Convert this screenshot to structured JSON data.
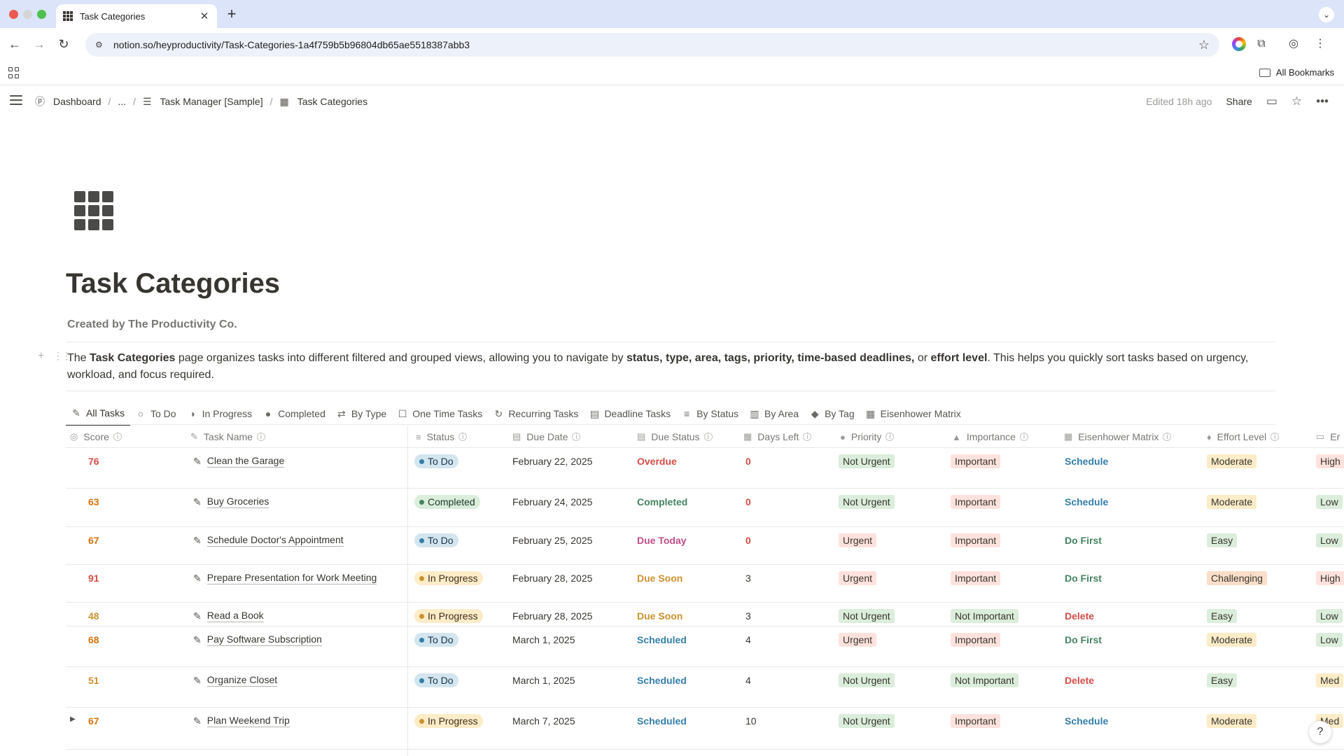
{
  "browser": {
    "tab_title": "Task Categories",
    "url": "notion.so/heyproductivity/Task-Categories-1a4f759b5b96804db65ae5518387abb3",
    "all_bookmarks": "All Bookmarks"
  },
  "breadcrumb": {
    "dashboard": "Dashboard",
    "ellipsis": "...",
    "task_manager": "Task Manager [Sample]",
    "current": "Task Categories"
  },
  "topbar": {
    "edited": "Edited 18h ago",
    "share": "Share"
  },
  "page": {
    "title": "Task Categories",
    "created_by": "Created by The Productivity Co.",
    "desc": {
      "p1": "The ",
      "b1": "Task Categories",
      "p2": " page organizes tasks into different filtered and grouped views, allowing you to navigate by ",
      "b2": "status, type, area, tags, priority, time-based deadlines,",
      "p3": " or ",
      "b3": "effort level",
      "p4": ". This helps you quickly sort tasks based on urgency, workload, and focus required."
    }
  },
  "views": [
    {
      "label": "All Tasks",
      "icon": "edit-icon"
    },
    {
      "label": "To Do",
      "icon": "circle-icon"
    },
    {
      "label": "In Progress",
      "icon": "half-circle-icon"
    },
    {
      "label": "Completed",
      "icon": "filled-circle-icon"
    },
    {
      "label": "By Type",
      "icon": "repeat-icon"
    },
    {
      "label": "One Time Tasks",
      "icon": "square-icon"
    },
    {
      "label": "Recurring Tasks",
      "icon": "refresh-icon"
    },
    {
      "label": "Deadline Tasks",
      "icon": "calendar-icon"
    },
    {
      "label": "By Status",
      "icon": "layers-icon"
    },
    {
      "label": "By Area",
      "icon": "building-icon"
    },
    {
      "label": "By Tag",
      "icon": "tag-icon"
    },
    {
      "label": "Eisenhower Matrix",
      "icon": "grid-icon"
    }
  ],
  "columns": {
    "score": "Score",
    "task_name": "Task Name",
    "status": "Status",
    "due_date": "Due Date",
    "due_status": "Due Status",
    "days_left": "Days Left",
    "priority": "Priority",
    "importance": "Importance",
    "eisenhower": "Eisenhower Matrix",
    "effort": "Effort Level",
    "energy": "Er"
  },
  "rows": [
    {
      "score": "76",
      "name": "Clean the Garage",
      "status": "To Do",
      "due_date": "February 22, 2025",
      "due_status": "Overdue",
      "days_left": "0",
      "priority": "Not Urgent",
      "importance": "Important",
      "eisenhower": "Schedule",
      "effort": "Moderate",
      "energy": "High"
    },
    {
      "score": "63",
      "name": "Buy Groceries",
      "status": "Completed",
      "due_date": "February 24, 2025",
      "due_status": "Completed",
      "days_left": "0",
      "priority": "Not Urgent",
      "importance": "Important",
      "eisenhower": "Schedule",
      "effort": "Moderate",
      "energy": "Low"
    },
    {
      "score": "67",
      "name": "Schedule Doctor's Appointment",
      "status": "To Do",
      "due_date": "February 25, 2025",
      "due_status": "Due Today",
      "days_left": "0",
      "priority": "Urgent",
      "importance": "Important",
      "eisenhower": "Do First",
      "effort": "Easy",
      "energy": "Low"
    },
    {
      "score": "91",
      "name": "Prepare Presentation for Work Meeting",
      "status": "In Progress",
      "due_date": "February 28, 2025",
      "due_status": "Due Soon",
      "days_left": "3",
      "priority": "Urgent",
      "importance": "Important",
      "eisenhower": "Do First",
      "effort": "Challenging",
      "energy": "High"
    },
    {
      "score": "48",
      "name": "Read a Book",
      "status": "In Progress",
      "due_date": "February 28, 2025",
      "due_status": "Due Soon",
      "days_left": "3",
      "priority": "Not Urgent",
      "importance": "Not Important",
      "eisenhower": "Delete",
      "effort": "Easy",
      "energy": "Low"
    },
    {
      "score": "68",
      "name": "Pay Software Subscription",
      "status": "To Do",
      "due_date": "March 1, 2025",
      "due_status": "Scheduled",
      "days_left": "4",
      "priority": "Urgent",
      "importance": "Important",
      "eisenhower": "Do First",
      "effort": "Moderate",
      "energy": "Low"
    },
    {
      "score": "51",
      "name": "Organize Closet",
      "status": "To Do",
      "due_date": "March 1, 2025",
      "due_status": "Scheduled",
      "days_left": "4",
      "priority": "Not Urgent",
      "importance": "Not Important",
      "eisenhower": "Delete",
      "effort": "Easy",
      "energy": "Med"
    },
    {
      "score": "67",
      "name": "Plan Weekend Trip",
      "status": "In Progress",
      "due_date": "March 7, 2025",
      "due_status": "Scheduled",
      "days_left": "10",
      "priority": "Not Urgent",
      "importance": "Important",
      "eisenhower": "Schedule",
      "effort": "Moderate",
      "energy": "Med"
    }
  ],
  "colors": {
    "score_high": "#d44c47",
    "score_mid": "#d9730d",
    "score_low": "#cb912f",
    "todo_bg": "#d3e5ef",
    "todo_fg": "#183347",
    "todo_dot": "#337ea9",
    "completed_bg": "#dbeddb",
    "completed_fg": "#1c3829",
    "completed_dot": "#448361",
    "progress_bg": "#fdecc8",
    "progress_fg": "#402c1b",
    "progress_dot": "#cb912f",
    "overdue": "#d44c47",
    "completed_text": "#448361",
    "due_today": "#c14c8a",
    "due_soon": "#cb912f",
    "scheduled": "#337ea9",
    "red_tag_bg": "#ffe2dd",
    "green_tag_bg": "#dbeddb",
    "yellow_tag_bg": "#fdecc8",
    "orange_tag_bg": "#fadec9"
  }
}
